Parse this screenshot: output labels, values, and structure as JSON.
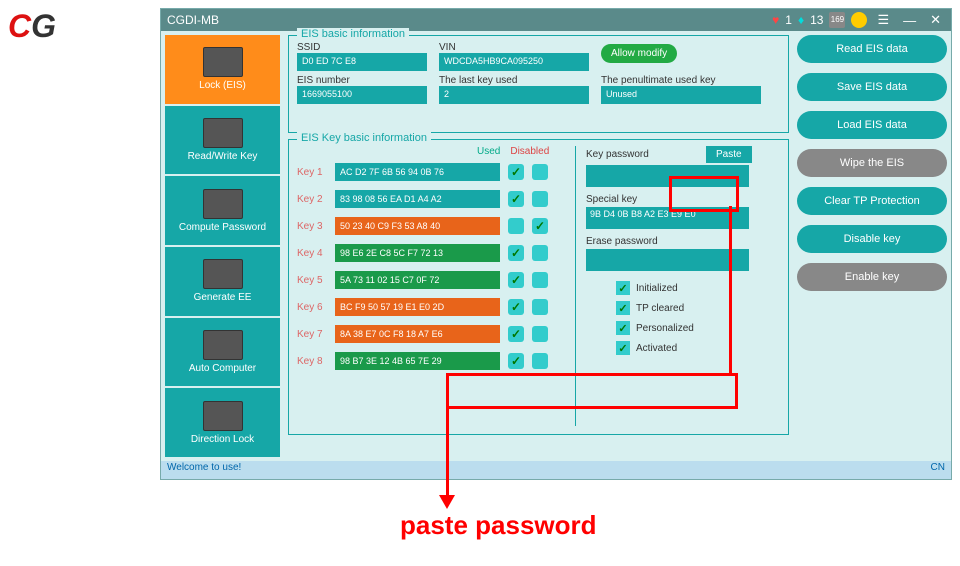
{
  "app": {
    "title": "CGDI-MB",
    "hearts": "1",
    "diamonds": "13",
    "counter": "169"
  },
  "sidebar": [
    {
      "label": "Lock (EIS)"
    },
    {
      "label": "Read/Write Key"
    },
    {
      "label": "Compute Password"
    },
    {
      "label": "Generate EE"
    },
    {
      "label": "Auto Computer"
    },
    {
      "label": "Direction Lock"
    }
  ],
  "basic": {
    "legend": "EIS basic information",
    "ssid_lbl": "SSID",
    "ssid": "D0 ED 7C E8",
    "vin_lbl": "VIN",
    "vin": "WDCDA5HB9CA095250",
    "allow": "Allow modify",
    "eisnum_lbl": "EIS number",
    "eisnum": "1669055100",
    "lastkey_lbl": "The last key used",
    "lastkey": "2",
    "penult_lbl": "The penultimate used key",
    "penult": "Unused"
  },
  "keyinfo": {
    "legend": "EIS Key basic information",
    "used_lbl": "Used",
    "disabled_lbl": "Disabled",
    "keys": [
      {
        "lbl": "Key 1",
        "val": "AC D2 7F 6B 56 94 0B 76",
        "c": "teal",
        "u": true,
        "d": false
      },
      {
        "lbl": "Key 2",
        "val": "83 98 08 56 EA D1 A4 A2",
        "c": "teal",
        "u": true,
        "d": false
      },
      {
        "lbl": "Key 3",
        "val": "50 23 40 C9 F3 53 A8 40",
        "c": "orange",
        "u": false,
        "d": true
      },
      {
        "lbl": "Key 4",
        "val": "98 E6 2E C8 5C F7 72 13",
        "c": "green",
        "u": true,
        "d": false
      },
      {
        "lbl": "Key 5",
        "val": "5A 73 11 02 15 C7 0F 72",
        "c": "green",
        "u": true,
        "d": false
      },
      {
        "lbl": "Key 6",
        "val": "BC F9 50 57 19 E1 E0 2D",
        "c": "orange",
        "u": true,
        "d": false
      },
      {
        "lbl": "Key 7",
        "val": "8A 38 E7 0C F8 18 A7 E6",
        "c": "orange",
        "u": true,
        "d": false
      },
      {
        "lbl": "Key 8",
        "val": "98 B7 3E 12 4B 65 7E 29",
        "c": "green",
        "u": true,
        "d": false
      }
    ],
    "keypass_lbl": "Key password",
    "paste": "Paste",
    "keypass": "",
    "special_lbl": "Special key",
    "special": "9B D4 0B B8 A2 E3 E9 E0",
    "erase_lbl": "Erase password",
    "erase": "",
    "status": [
      {
        "lbl": "Initialized",
        "on": true
      },
      {
        "lbl": "TP cleared",
        "on": true
      },
      {
        "lbl": "Personalized",
        "on": true
      },
      {
        "lbl": "Activated",
        "on": true
      }
    ]
  },
  "actions": [
    "Read EIS data",
    "Save EIS data",
    "Load EIS data",
    "Wipe the EIS",
    "Clear TP Protection",
    "Disable key",
    "Enable key"
  ],
  "footer": {
    "msg": "Welcome to use!",
    "lang": "CN"
  },
  "annotation": "paste password"
}
